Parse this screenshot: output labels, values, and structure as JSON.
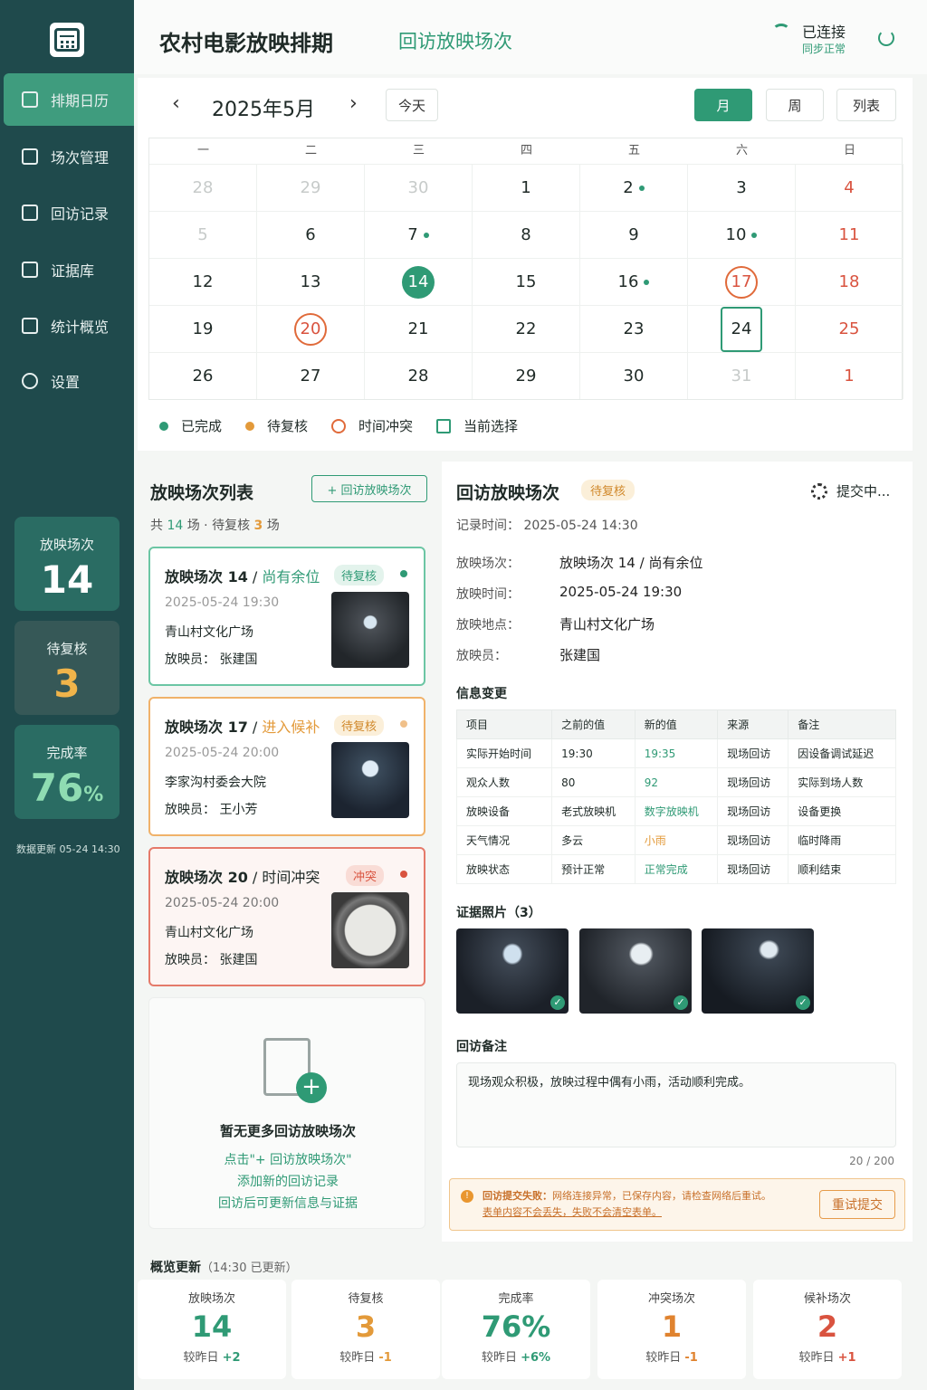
{
  "app": {
    "title": "农村电影放映排期",
    "subtitle": "回访放映场次",
    "status": "已连接",
    "sync": "同步正常"
  },
  "sidebar": {
    "items": [
      {
        "label": "排期日历",
        "icon": "calendar-icon",
        "active": true
      },
      {
        "label": "场次管理",
        "icon": "session-icon"
      },
      {
        "label": "回访记录",
        "icon": "checklist-icon"
      },
      {
        "label": "证据库",
        "icon": "archive-icon"
      },
      {
        "label": "统计概览",
        "icon": "chart-icon"
      },
      {
        "label": "设置",
        "icon": "gear-icon"
      }
    ],
    "stats": [
      {
        "label": "放映场次",
        "value": "14"
      },
      {
        "label": "待复核",
        "value": "3"
      },
      {
        "label": "完成率",
        "value": "76",
        "unit": "%"
      }
    ],
    "updated": "数据更新 05-24 14:30"
  },
  "calendar": {
    "month": "2025年5月",
    "today": "今天",
    "views": [
      "月",
      "周",
      "列表"
    ],
    "weekdays": [
      "一",
      "二",
      "三",
      "四",
      "五",
      "六",
      "日"
    ],
    "weeks": [
      [
        "28",
        "29",
        "30",
        "1",
        "2",
        "3",
        "4"
      ],
      [
        "5",
        "6",
        "7",
        "8",
        "9",
        "10",
        "11"
      ],
      [
        "12",
        "13",
        "14",
        "15",
        "16",
        "17",
        "18"
      ],
      [
        "19",
        "20",
        "21",
        "22",
        "23",
        "24",
        "25"
      ],
      [
        "26",
        "27",
        "28",
        "29",
        "30",
        "31",
        "1"
      ]
    ],
    "legend": [
      "已完成",
      "待复核",
      "时间冲突",
      "当前选择"
    ]
  },
  "list": {
    "title": "放映场次列表",
    "add": "+ 回访放映场次",
    "summary_prefix": "共",
    "summary_total": "14",
    "summary_mid": "场 · 待复核",
    "summary_pending": "3",
    "summary_suffix": "场",
    "items": [
      {
        "name": "放映场次 14",
        "sep": " / ",
        "status": "尚有余位",
        "badge": "待复核",
        "time": "2025-05-24 19:30",
        "place": "青山村文化广场",
        "operator": "放映员： 张建国"
      },
      {
        "name": "放映场次 17",
        "sep": " / ",
        "status": "进入候补",
        "badge": "待复核",
        "time": "2025-05-24 20:00",
        "place": "李家沟村委会大院",
        "operator": "放映员： 王小芳"
      },
      {
        "name": "放映场次 20",
        "sep": " / ",
        "status": "时间冲突",
        "badge": "冲突",
        "time": "2025-05-24 20:00",
        "place": "青山村文化广场",
        "operator": "放映员： 张建国"
      }
    ],
    "empty": {
      "title": "暂无更多回访放映场次",
      "line1": "点击\"+ 回访放映场次\"",
      "line2": "添加新的回访记录",
      "line3": "回访后可更新信息与证据"
    }
  },
  "detail": {
    "title": "回访放映场次",
    "badge": "待复核",
    "submitting": "提交中...",
    "record_time": "记录时间： 2025-05-24 14:30",
    "fields": [
      {
        "label": "放映场次：",
        "value": "放映场次 14 / 尚有余位"
      },
      {
        "label": "放映时间：",
        "value": "2025-05-24 19:30"
      },
      {
        "label": "放映地点：",
        "value": "青山村文化广场"
      },
      {
        "label": "放映员：",
        "value": "张建国"
      }
    ],
    "changes_title": "信息变更",
    "changes_headers": [
      "项目",
      "之前的值",
      "新的值",
      "来源",
      "备注"
    ],
    "changes": [
      [
        "实际开始时间",
        "19:30",
        "19:35",
        "现场回访",
        "因设备调试延迟"
      ],
      [
        "观众人数",
        "80",
        "92",
        "现场回访",
        "实际到场人数"
      ],
      [
        "放映设备",
        "老式放映机",
        "数字放映机",
        "现场回访",
        "设备更换"
      ],
      [
        "天气情况",
        "多云",
        "小雨",
        "现场回访",
        "临时降雨"
      ],
      [
        "放映状态",
        "预计正常",
        "正常完成",
        "现场回访",
        "顺利结束"
      ]
    ],
    "photos_title": "证据照片（3）",
    "notes_title": "回访备注",
    "notes": "现场观众积极，放映过程中偶有小雨，活动顺利完成。",
    "char_count": "20 / 200",
    "error_title": "回访提交失败：",
    "error_msg": "网络连接异常，已保存内容，请检查网络后重试。",
    "error_line2": "表单内容不会丢失，失败不会清空表单。",
    "retry": "重试提交"
  },
  "overview": {
    "title": "概览更新",
    "updated": "（14:30 已更新）",
    "cards": [
      {
        "label": "放映场次",
        "value": "14",
        "delta_label": "较昨日",
        "delta": "+2",
        "color": "#2f9a75"
      },
      {
        "label": "待复核",
        "value": "3",
        "delta_label": "较昨日",
        "delta": "-1",
        "color": "#e39a3a"
      },
      {
        "label": "完成率",
        "value": "76%",
        "delta_label": "较昨日",
        "delta": "+6%",
        "color": "#2f9a75"
      },
      {
        "label": "冲突场次",
        "value": "1",
        "delta_label": "较昨日",
        "delta": "-1",
        "color": "#e0832f"
      },
      {
        "label": "候补场次",
        "value": "2",
        "delta_label": "较昨日",
        "delta": "+1",
        "color": "#d9533f"
      }
    ]
  },
  "colors": {
    "sidebar": "#1f4a4c",
    "accent": "#2f9a75",
    "warning": "#e39a3a",
    "danger": "#d9533f"
  }
}
